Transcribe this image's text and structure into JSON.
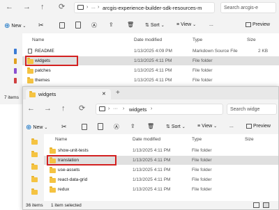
{
  "back_window": {
    "address": "arcgis-experience-builder-sdk-resources-m",
    "search_placeholder": "Search arcgis-e",
    "new_label": "New",
    "sort_label": "Sort",
    "view_label": "View",
    "preview_label": "Preview",
    "more_label": "...",
    "columns": [
      "Name",
      "Date modified",
      "Type",
      "Size"
    ],
    "rows": [
      {
        "name": "README",
        "date": "1/13/2025 4:09 PM",
        "type": "Markdown Source File",
        "size": "2 KB"
      },
      {
        "name": "widgets",
        "date": "1/13/2025 4:11 PM",
        "type": "File folder",
        "size": ""
      },
      {
        "name": "patches",
        "date": "1/13/2025 4:11 PM",
        "type": "File folder",
        "size": ""
      },
      {
        "name": "themes",
        "date": "1/13/2025 4:11 PM",
        "type": "File folder",
        "size": ""
      }
    ],
    "status": "7 items"
  },
  "front_window": {
    "tab_title": "widgets",
    "new_tab": "+",
    "breadcrumb_more": "···",
    "breadcrumb": "widgets",
    "search_placeholder": "Search widge",
    "new_label": "New",
    "sort_label": "Sort",
    "view_label": "View",
    "preview_label": "Preview",
    "more_label": "...",
    "columns": [
      "Name",
      "Date modified",
      "Type",
      "Size"
    ],
    "rows": [
      {
        "name": "show-unit-tests",
        "date": "1/13/2025 4:11 PM",
        "type": "File folder"
      },
      {
        "name": "translation",
        "date": "1/13/2025 4:11 PM",
        "type": "File folder"
      },
      {
        "name": "use-assets",
        "date": "1/13/2025 4:11 PM",
        "type": "File folder"
      },
      {
        "name": "react-data-grid",
        "date": "1/13/2025 4:11 PM",
        "type": "File folder"
      },
      {
        "name": "redux",
        "date": "1/13/2025 4:11 PM",
        "type": "File folder"
      }
    ],
    "status_count": "36 items",
    "status_selected": "1 item selected"
  },
  "colors": {
    "highlight": "#d32020",
    "folder": "#f5c342",
    "accent": "#0067c0"
  }
}
